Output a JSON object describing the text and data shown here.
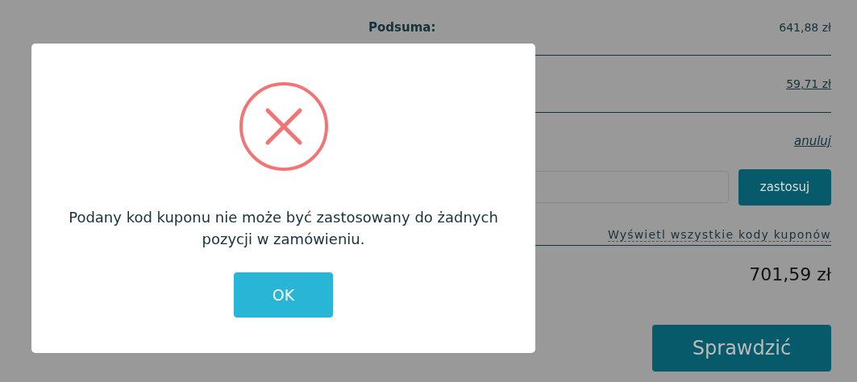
{
  "summary": {
    "subtotal_label": "Podsuma:",
    "subtotal_value": "641,88 zł",
    "row_2_value": "59,71 zł",
    "cancel_link": "anuluj",
    "apply_button": "zastosuj",
    "show_coupons_link": "Wyświetl wszystkie kody kuponów",
    "total_value": "701,59 zł",
    "checkout_button": "Sprawdzić"
  },
  "dialog": {
    "kind": "error",
    "message": "Podany kod kuponu nie może być zastosowany do żadnych pozycji w zamówieniu.",
    "ok_button": "OK"
  }
}
